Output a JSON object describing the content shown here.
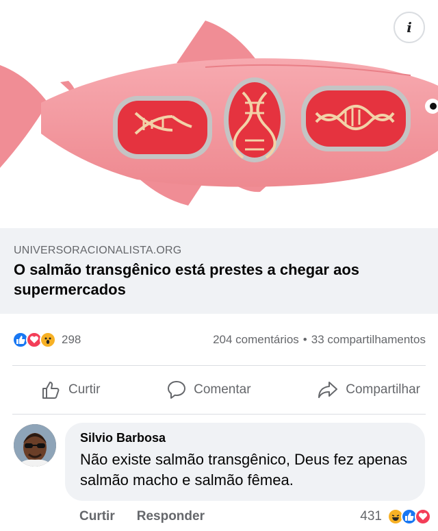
{
  "post": {
    "domain": "UNIVERSORACIONALISTA.ORG",
    "headline": "O salmão transgênico está prestes a chegar aos supermercados",
    "info_icon": "i",
    "image_icon": "fish-dna-illustration"
  },
  "stats": {
    "reaction_count": "298",
    "comments": "204 comentários",
    "separator": "•",
    "shares": "33 compartilhamentos",
    "reactions": [
      "like",
      "love",
      "wow"
    ]
  },
  "actions": {
    "like_label": "Curtir",
    "comment_label": "Comentar",
    "share_label": "Compartilhar"
  },
  "comment": {
    "author": "Silvio Barbosa",
    "text": "Não existe salmão transgênico, Deus fez apenas salmão macho e salmão fêmea.",
    "like_label": "Curtir",
    "reply_label": "Responder",
    "reaction_count": "431",
    "reactions": [
      "haha",
      "like",
      "love"
    ]
  },
  "colors": {
    "fish_body": "#f49a9f",
    "organ": "#e5333f",
    "like_blue": "#1877f2",
    "love_red": "#f33e58",
    "secondary_text": "#65676b"
  }
}
